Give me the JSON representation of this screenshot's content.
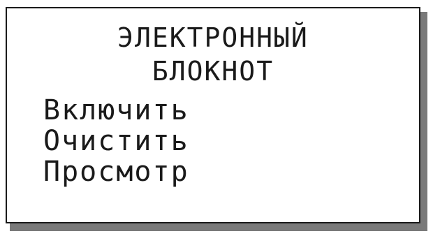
{
  "screen": {
    "title_line_1": "ЭЛЕКТРОННЫЙ",
    "title_line_2": "БЛОКНОТ",
    "menu": [
      {
        "label": "Включить"
      },
      {
        "label": "Очистить"
      },
      {
        "label": "Просмотр"
      }
    ]
  }
}
